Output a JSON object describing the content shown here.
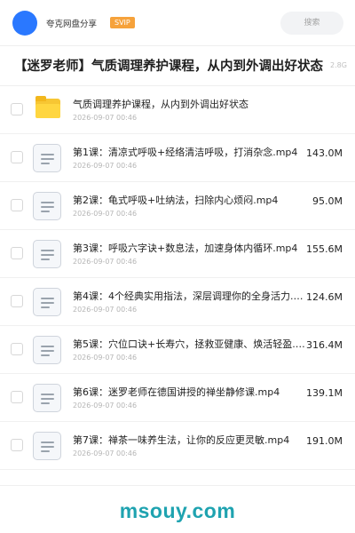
{
  "header": {
    "user_name": "夸克网盘分享",
    "badge": "SVIP",
    "search_placeholder": "搜索"
  },
  "share": {
    "title": "【迷罗老师】气质调理养护课程，从内到外调出好状态",
    "size": "2.8G"
  },
  "files": [
    {
      "type": "folder",
      "name": "气质调理养护课程，从内到外调出好状态",
      "date": "2026-09-07 00:46",
      "size": ""
    },
    {
      "type": "video",
      "name": "第1课：清凉式呼吸+经络清洁呼吸，打消杂念.mp4",
      "date": "2026-09-07 00:46",
      "size": "143.0M"
    },
    {
      "type": "video",
      "name": "第2课：龟式呼吸+吐纳法，扫除内心烦闷.mp4",
      "date": "2026-09-07 00:46",
      "size": "95.0M"
    },
    {
      "type": "video",
      "name": "第3课：呼吸六字诀+数息法，加速身体内循环.mp4",
      "date": "2026-09-07 00:46",
      "size": "155.6M"
    },
    {
      "type": "video",
      "name": "第4课：4个经典实用指法，深层调理你的全身活力.m…",
      "date": "2026-09-07 00:46",
      "size": "124.6M"
    },
    {
      "type": "video",
      "name": "第5课：穴位口诀+长寿穴，拯救亚健康、焕活轻盈.m…",
      "date": "2026-09-07 00:46",
      "size": "316.4M"
    },
    {
      "type": "video",
      "name": "第6课：迷罗老师在德国讲授的禅坐静修课.mp4",
      "date": "2026-09-07 00:46",
      "size": "139.1M"
    },
    {
      "type": "video",
      "name": "第7课：禅茶一味养生法，让你的反应更灵敏.mp4",
      "date": "2026-09-07 00:46",
      "size": "191.0M"
    }
  ],
  "watermark": "msouy.com"
}
